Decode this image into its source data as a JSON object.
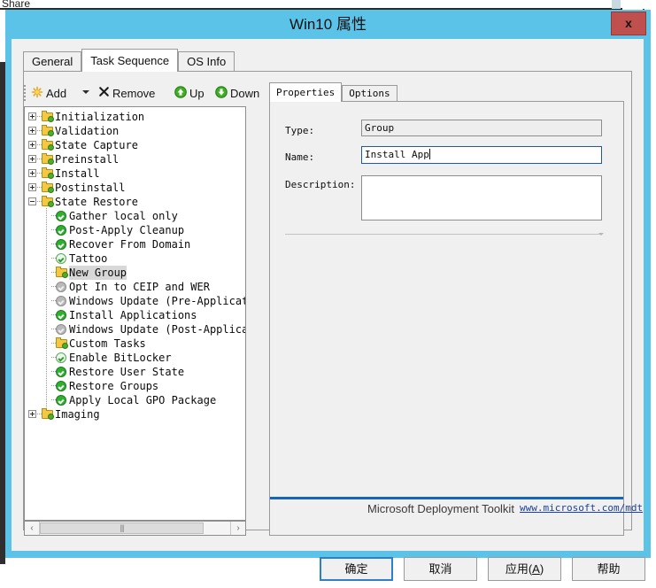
{
  "background": {
    "ribbon_label": "Share"
  },
  "dialog": {
    "title": "Win10 属性",
    "close_label": "x",
    "close_icon": "close-icon",
    "accent_color": "#5bc3e8",
    "close_color": "#c0504d"
  },
  "tabs": [
    {
      "label": "General",
      "active": false
    },
    {
      "label": "Task Sequence",
      "active": true
    },
    {
      "label": "OS Info",
      "active": false
    }
  ],
  "toolbar": {
    "add_label": "Add",
    "add_icon": "starburst-icon",
    "add_dropdown_icon": "chevron-down-icon",
    "remove_label": "Remove",
    "remove_icon": "x-icon",
    "up_label": "Up",
    "up_icon": "arrow-up-circle-icon",
    "down_label": "Down",
    "down_icon": "arrow-down-circle-icon"
  },
  "tree": {
    "nodes": [
      {
        "label": "Initialization",
        "depth": 0,
        "expander": "plus",
        "icon": "folder"
      },
      {
        "label": "Validation",
        "depth": 0,
        "expander": "plus",
        "icon": "folder"
      },
      {
        "label": "State Capture",
        "depth": 0,
        "expander": "plus",
        "icon": "folder"
      },
      {
        "label": "Preinstall",
        "depth": 0,
        "expander": "plus",
        "icon": "folder"
      },
      {
        "label": "Install",
        "depth": 0,
        "expander": "plus",
        "icon": "folder"
      },
      {
        "label": "Postinstall",
        "depth": 0,
        "expander": "plus",
        "icon": "folder"
      },
      {
        "label": "State Restore",
        "depth": 0,
        "expander": "minus",
        "icon": "folder"
      },
      {
        "label": "Gather local only",
        "depth": 1,
        "expander": "none",
        "icon": "check"
      },
      {
        "label": "Post-Apply Cleanup",
        "depth": 1,
        "expander": "none",
        "icon": "check"
      },
      {
        "label": "Recover From Domain",
        "depth": 1,
        "expander": "none",
        "icon": "check"
      },
      {
        "label": "Tattoo",
        "depth": 1,
        "expander": "none",
        "icon": "check-pale"
      },
      {
        "label": "New Group",
        "depth": 1,
        "expander": "none",
        "icon": "folder",
        "selected": true
      },
      {
        "label": "Opt In to CEIP and WER",
        "depth": 1,
        "expander": "none",
        "icon": "check-gray"
      },
      {
        "label": "Windows Update (Pre-Application Installation)",
        "depth": 1,
        "expander": "none",
        "icon": "check-gray"
      },
      {
        "label": "Install Applications",
        "depth": 1,
        "expander": "none",
        "icon": "check"
      },
      {
        "label": "Windows Update (Post-Application Installation)",
        "depth": 1,
        "expander": "none",
        "icon": "check-gray"
      },
      {
        "label": "Custom Tasks",
        "depth": 1,
        "expander": "none",
        "icon": "folder"
      },
      {
        "label": "Enable BitLocker",
        "depth": 1,
        "expander": "none",
        "icon": "check-pale"
      },
      {
        "label": "Restore User State",
        "depth": 1,
        "expander": "none",
        "icon": "check"
      },
      {
        "label": "Restore Groups",
        "depth": 1,
        "expander": "none",
        "icon": "check"
      },
      {
        "label": "Apply Local GPO Package",
        "depth": 1,
        "expander": "none",
        "icon": "check"
      },
      {
        "label": "Imaging",
        "depth": 0,
        "expander": "plus",
        "icon": "folder"
      }
    ],
    "scrollbar": {
      "left_arrow": "‹",
      "right_arrow": "›",
      "grip": "|||"
    }
  },
  "properties": {
    "tabs": [
      {
        "label": "Properties",
        "active": true
      },
      {
        "label": "Options",
        "active": false
      }
    ],
    "type_label": "Type:",
    "type_value": "Group",
    "name_label": "Name:",
    "name_value": "Install App",
    "description_label": "Description:",
    "description_value": ""
  },
  "branding": {
    "text": "Microsoft Deployment Toolkit",
    "link": "www.microsoft.com/mdt",
    "rule_color": "#1565c0"
  },
  "buttons": {
    "ok": "确定",
    "cancel": "取消",
    "apply_prefix": "应用(",
    "apply_key": "A",
    "apply_suffix": ")",
    "help": "帮助"
  }
}
